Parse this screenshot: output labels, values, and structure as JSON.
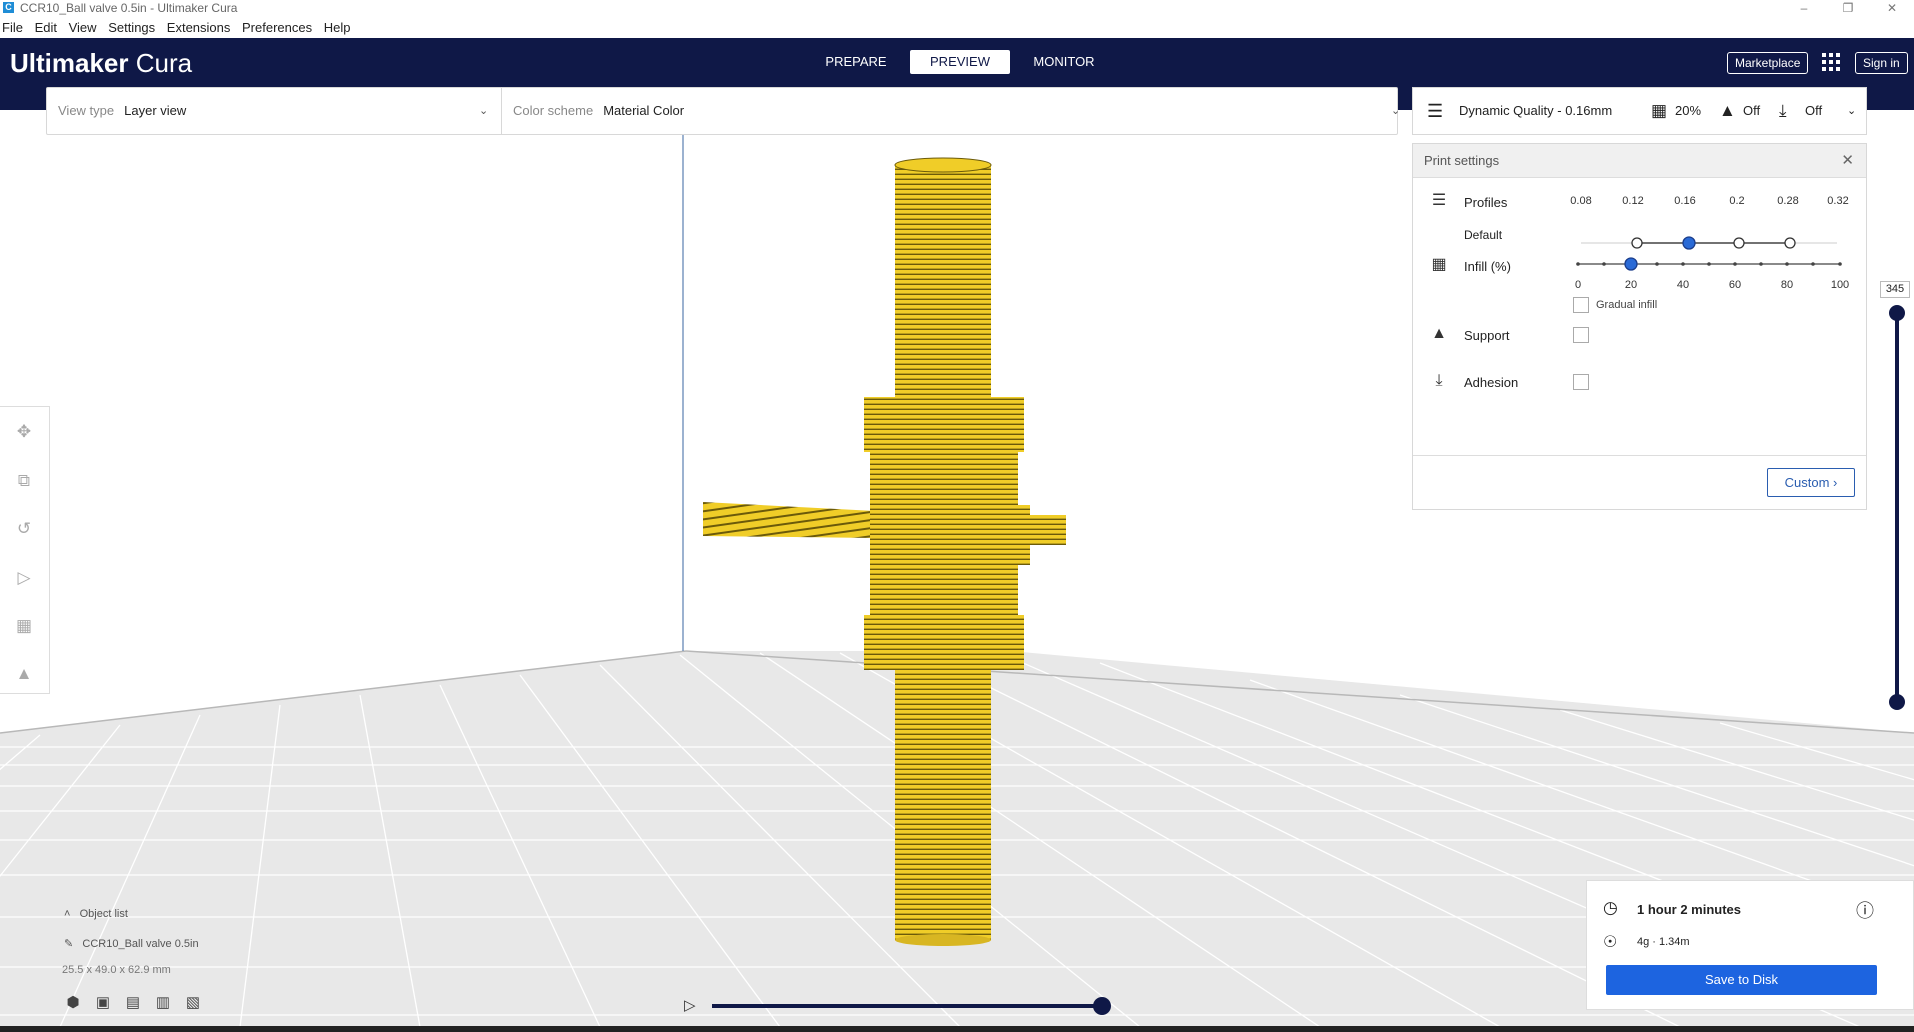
{
  "window": {
    "title": "CCR10_Ball valve 0.5in - Ultimaker Cura",
    "app_icon": "C",
    "controls": [
      "–",
      "❐",
      "✕"
    ]
  },
  "menu": {
    "items": [
      "File",
      "Edit",
      "View",
      "Settings",
      "Extensions",
      "Preferences",
      "Help"
    ]
  },
  "header": {
    "logo_bold": "Ultimaker",
    "logo_light": " Cura",
    "tabs": [
      {
        "label": "PREPARE",
        "active": false
      },
      {
        "label": "PREVIEW",
        "active": true
      },
      {
        "label": "MONITOR",
        "active": false
      }
    ],
    "marketplace_label": "Marketplace",
    "signin_label": "Sign in"
  },
  "view_bar": {
    "view_type_label": "View type",
    "view_type_value": "Layer view",
    "color_scheme_label": "Color scheme",
    "color_scheme_value": "Material Color"
  },
  "print_bar": {
    "profile": "Dynamic Quality - 0.16mm",
    "infill": "20%",
    "support": "Off",
    "adhesion": "Off"
  },
  "print_settings": {
    "title": "Print settings",
    "profiles_label": "Profiles",
    "default_label": "Default",
    "layer_heights": [
      "0.08",
      "0.12",
      "0.16",
      "0.2",
      "0.28",
      "0.32"
    ],
    "selected_layer_height": "0.16",
    "infill_label": "Infill (%)",
    "infill_ticks": [
      "0",
      "20",
      "40",
      "60",
      "80",
      "100"
    ],
    "infill_value": 20,
    "gradual_infill_label": "Gradual infill",
    "support_label": "Support",
    "adhesion_label": "Adhesion",
    "custom_label": "Custom"
  },
  "layer_slider": {
    "value": "345"
  },
  "object_list": {
    "header": "Object list",
    "object_name": "CCR10_Ball valve 0.5in",
    "dimensions": "25.5 x 49.0 x 62.9 mm"
  },
  "estimate": {
    "time": "1 hour 2 minutes",
    "material": "4g · 1.34m",
    "save_label": "Save to Disk"
  },
  "colors": {
    "header": "#0f1847",
    "accent": "#1d64e0",
    "model": "#f2cf2a"
  }
}
